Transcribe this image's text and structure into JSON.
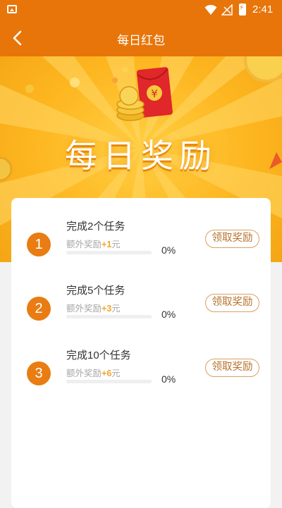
{
  "status_bar": {
    "time": "2:41"
  },
  "header": {
    "title": "每日红包"
  },
  "banner": {
    "title": "每日奖励",
    "currency_symbol": "¥"
  },
  "tasks": [
    {
      "index": "1",
      "name": "完成2个任务",
      "extra_prefix": "额外奖励",
      "extra_amount": "+1",
      "extra_unit": "元",
      "progress": 0,
      "percent": "0%",
      "claim_label": "领取奖励"
    },
    {
      "index": "2",
      "name": "完成5个任务",
      "extra_prefix": "额外奖励",
      "extra_amount": "+3",
      "extra_unit": "元",
      "progress": 0,
      "percent": "0%",
      "claim_label": "领取奖励"
    },
    {
      "index": "3",
      "name": "完成10个任务",
      "extra_prefix": "额外奖励",
      "extra_amount": "+6",
      "extra_unit": "元",
      "progress": 0,
      "percent": "0%",
      "claim_label": "领取奖励"
    }
  ],
  "colors": {
    "primary": "#e8750a",
    "accent": "#f0a52b",
    "claim_border": "#d8a064"
  },
  "icons": [
    "image-icon",
    "wifi-icon",
    "signal-icon",
    "battery-icon",
    "back-arrow-icon",
    "red-envelope-icon",
    "coin-stack-icon"
  ]
}
